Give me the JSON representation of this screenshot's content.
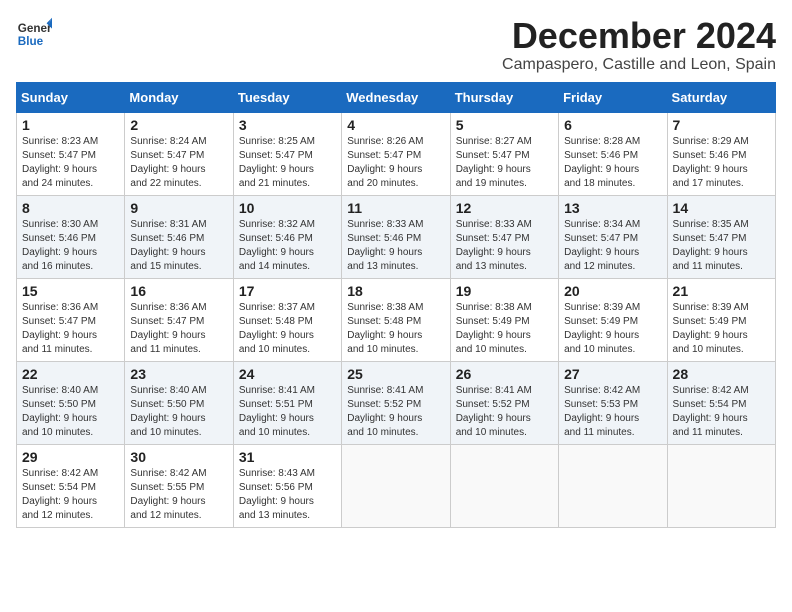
{
  "header": {
    "logo_line1": "General",
    "logo_line2": "Blue",
    "month_title": "December 2024",
    "location": "Campaspero, Castille and Leon, Spain"
  },
  "calendar": {
    "days_of_week": [
      "Sunday",
      "Monday",
      "Tuesday",
      "Wednesday",
      "Thursday",
      "Friday",
      "Saturday"
    ],
    "weeks": [
      [
        {
          "day": "",
          "info": ""
        },
        {
          "day": "2",
          "info": "Sunrise: 8:24 AM\nSunset: 5:47 PM\nDaylight: 9 hours\nand 22 minutes."
        },
        {
          "day": "3",
          "info": "Sunrise: 8:25 AM\nSunset: 5:47 PM\nDaylight: 9 hours\nand 21 minutes."
        },
        {
          "day": "4",
          "info": "Sunrise: 8:26 AM\nSunset: 5:47 PM\nDaylight: 9 hours\nand 20 minutes."
        },
        {
          "day": "5",
          "info": "Sunrise: 8:27 AM\nSunset: 5:47 PM\nDaylight: 9 hours\nand 19 minutes."
        },
        {
          "day": "6",
          "info": "Sunrise: 8:28 AM\nSunset: 5:46 PM\nDaylight: 9 hours\nand 18 minutes."
        },
        {
          "day": "7",
          "info": "Sunrise: 8:29 AM\nSunset: 5:46 PM\nDaylight: 9 hours\nand 17 minutes."
        }
      ],
      [
        {
          "day": "1",
          "info": "Sunrise: 8:23 AM\nSunset: 5:47 PM\nDaylight: 9 hours\nand 24 minutes."
        },
        {
          "day": "2",
          "info": "Sunrise: 8:24 AM\nSunset: 5:47 PM\nDaylight: 9 hours\nand 22 minutes."
        },
        {
          "day": "3",
          "info": "Sunrise: 8:25 AM\nSunset: 5:47 PM\nDaylight: 9 hours\nand 21 minutes."
        },
        {
          "day": "4",
          "info": "Sunrise: 8:26 AM\nSunset: 5:47 PM\nDaylight: 9 hours\nand 20 minutes."
        },
        {
          "day": "5",
          "info": "Sunrise: 8:27 AM\nSunset: 5:47 PM\nDaylight: 9 hours\nand 19 minutes."
        },
        {
          "day": "6",
          "info": "Sunrise: 8:28 AM\nSunset: 5:46 PM\nDaylight: 9 hours\nand 18 minutes."
        },
        {
          "day": "7",
          "info": "Sunrise: 8:29 AM\nSunset: 5:46 PM\nDaylight: 9 hours\nand 17 minutes."
        }
      ],
      [
        {
          "day": "8",
          "info": "Sunrise: 8:30 AM\nSunset: 5:46 PM\nDaylight: 9 hours\nand 16 minutes."
        },
        {
          "day": "9",
          "info": "Sunrise: 8:31 AM\nSunset: 5:46 PM\nDaylight: 9 hours\nand 15 minutes."
        },
        {
          "day": "10",
          "info": "Sunrise: 8:32 AM\nSunset: 5:46 PM\nDaylight: 9 hours\nand 14 minutes."
        },
        {
          "day": "11",
          "info": "Sunrise: 8:33 AM\nSunset: 5:46 PM\nDaylight: 9 hours\nand 13 minutes."
        },
        {
          "day": "12",
          "info": "Sunrise: 8:33 AM\nSunset: 5:47 PM\nDaylight: 9 hours\nand 13 minutes."
        },
        {
          "day": "13",
          "info": "Sunrise: 8:34 AM\nSunset: 5:47 PM\nDaylight: 9 hours\nand 12 minutes."
        },
        {
          "day": "14",
          "info": "Sunrise: 8:35 AM\nSunset: 5:47 PM\nDaylight: 9 hours\nand 11 minutes."
        }
      ],
      [
        {
          "day": "15",
          "info": "Sunrise: 8:36 AM\nSunset: 5:47 PM\nDaylight: 9 hours\nand 11 minutes."
        },
        {
          "day": "16",
          "info": "Sunrise: 8:36 AM\nSunset: 5:47 PM\nDaylight: 9 hours\nand 11 minutes."
        },
        {
          "day": "17",
          "info": "Sunrise: 8:37 AM\nSunset: 5:48 PM\nDaylight: 9 hours\nand 10 minutes."
        },
        {
          "day": "18",
          "info": "Sunrise: 8:38 AM\nSunset: 5:48 PM\nDaylight: 9 hours\nand 10 minutes."
        },
        {
          "day": "19",
          "info": "Sunrise: 8:38 AM\nSunset: 5:49 PM\nDaylight: 9 hours\nand 10 minutes."
        },
        {
          "day": "20",
          "info": "Sunrise: 8:39 AM\nSunset: 5:49 PM\nDaylight: 9 hours\nand 10 minutes."
        },
        {
          "day": "21",
          "info": "Sunrise: 8:39 AM\nSunset: 5:49 PM\nDaylight: 9 hours\nand 10 minutes."
        }
      ],
      [
        {
          "day": "22",
          "info": "Sunrise: 8:40 AM\nSunset: 5:50 PM\nDaylight: 9 hours\nand 10 minutes."
        },
        {
          "day": "23",
          "info": "Sunrise: 8:40 AM\nSunset: 5:50 PM\nDaylight: 9 hours\nand 10 minutes."
        },
        {
          "day": "24",
          "info": "Sunrise: 8:41 AM\nSunset: 5:51 PM\nDaylight: 9 hours\nand 10 minutes."
        },
        {
          "day": "25",
          "info": "Sunrise: 8:41 AM\nSunset: 5:52 PM\nDaylight: 9 hours\nand 10 minutes."
        },
        {
          "day": "26",
          "info": "Sunrise: 8:41 AM\nSunset: 5:52 PM\nDaylight: 9 hours\nand 10 minutes."
        },
        {
          "day": "27",
          "info": "Sunrise: 8:42 AM\nSunset: 5:53 PM\nDaylight: 9 hours\nand 11 minutes."
        },
        {
          "day": "28",
          "info": "Sunrise: 8:42 AM\nSunset: 5:54 PM\nDaylight: 9 hours\nand 11 minutes."
        }
      ],
      [
        {
          "day": "29",
          "info": "Sunrise: 8:42 AM\nSunset: 5:54 PM\nDaylight: 9 hours\nand 12 minutes."
        },
        {
          "day": "30",
          "info": "Sunrise: 8:42 AM\nSunset: 5:55 PM\nDaylight: 9 hours\nand 12 minutes."
        },
        {
          "day": "31",
          "info": "Sunrise: 8:43 AM\nSunset: 5:56 PM\nDaylight: 9 hours\nand 13 minutes."
        },
        {
          "day": "",
          "info": ""
        },
        {
          "day": "",
          "info": ""
        },
        {
          "day": "",
          "info": ""
        },
        {
          "day": "",
          "info": ""
        }
      ]
    ]
  }
}
